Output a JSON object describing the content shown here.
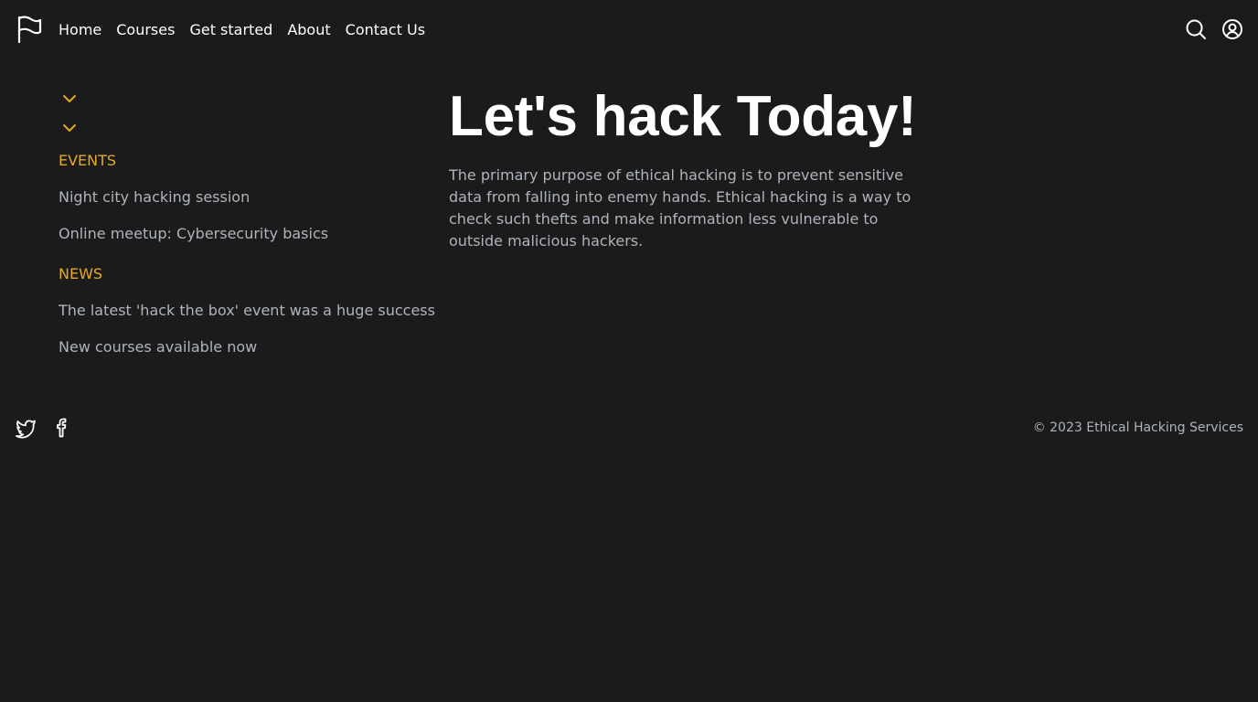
{
  "header": {
    "logo_icon": "flag-icon",
    "nav": [
      {
        "label": "Home"
      },
      {
        "label": "Courses"
      },
      {
        "label": "Get started"
      },
      {
        "label": "About"
      },
      {
        "label": "Contact Us"
      }
    ],
    "search_icon": "search-icon",
    "account_icon": "user-circle-icon"
  },
  "sidebar": {
    "toggle_icons": [
      "chevron-down-icon",
      "chevron-down-icon"
    ],
    "events": {
      "title": "EVENTS",
      "items": [
        {
          "label": "Night city hacking session"
        },
        {
          "label": "Online meetup: Cybersecurity basics"
        }
      ]
    },
    "news": {
      "title": "NEWS",
      "items": [
        {
          "label": "The latest 'hack the box' event was a huge success"
        },
        {
          "label": "New courses available now"
        }
      ]
    }
  },
  "main": {
    "heading": "Let's hack Today!",
    "body": "The primary purpose of ethical hacking is to prevent sensitive data from falling into enemy hands. Ethical hacking is a way to check such thefts and make information less vulnerable to outside malicious hackers."
  },
  "footer": {
    "social_icons": [
      "twitter-icon",
      "facebook-icon"
    ],
    "copyright": "© 2023 Ethical Hacking Services"
  },
  "colors": {
    "background": "#1b1b1b",
    "accent": "#e5a823",
    "text_primary": "#ffffff",
    "text_secondary": "#aeb4bd"
  }
}
